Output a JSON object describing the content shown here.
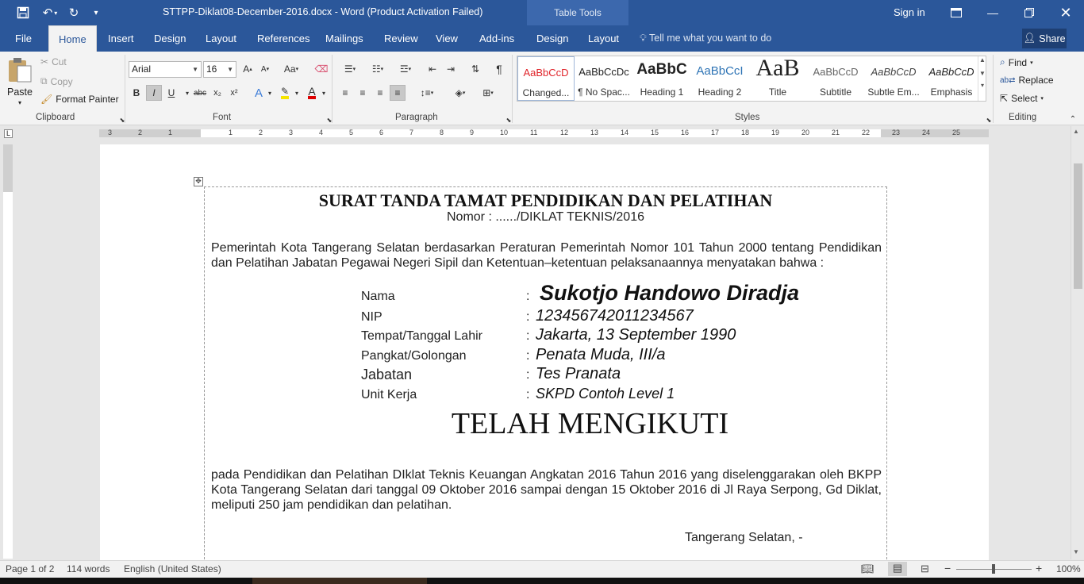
{
  "titlebar": {
    "doc_title": "STTPP-Diklat08-December-2016.docx  -  Word (Product Activation Failed)",
    "table_tools": "Table Tools",
    "sign_in": "Sign in",
    "share": "Share"
  },
  "tabs": [
    "File",
    "Home",
    "Insert",
    "Design",
    "Layout",
    "References",
    "Mailings",
    "Review",
    "View",
    "Add-ins",
    "Design",
    "Layout"
  ],
  "tell_me": "Tell me what you want to do",
  "clipboard": {
    "paste": "Paste",
    "cut": "Cut",
    "copy": "Copy",
    "format_painter": "Format Painter",
    "label": "Clipboard"
  },
  "font": {
    "name": "Arial",
    "size": "16",
    "label": "Font",
    "bold": "B",
    "italic": "I",
    "underline": "U",
    "strike": "abc",
    "sub": "x₂",
    "sup": "x²",
    "case": "Aa"
  },
  "paragraph": {
    "label": "Paragraph"
  },
  "styles": {
    "label": "Styles",
    "items": [
      {
        "preview": "AaBbCcD",
        "name": "Changed...",
        "color": "#e0242a"
      },
      {
        "preview": "AaBbCcDc",
        "name": "¶ No Spac...",
        "color": "#111111"
      },
      {
        "preview": "AaBbC",
        "name": "Heading 1",
        "color": "#111111"
      },
      {
        "preview": "AaBbCcI",
        "name": "Heading 2",
        "color": "#2e74b5"
      },
      {
        "preview": "AaB",
        "name": "Title",
        "color": "#111111"
      },
      {
        "preview": "AaBbCcD",
        "name": "Subtitle",
        "color": "#666666"
      },
      {
        "preview": "AaBbCcD",
        "name": "Subtle Em...",
        "color": "#444444"
      },
      {
        "preview": "AaBbCcD",
        "name": "Emphasis",
        "color": "#222222"
      }
    ]
  },
  "editing": {
    "find": "Find",
    "replace": "Replace",
    "select": "Select",
    "label": "Editing"
  },
  "ruler_marks": [
    "3",
    "2",
    "1",
    "1",
    "2",
    "3",
    "4",
    "5",
    "6",
    "7",
    "8",
    "9",
    "10",
    "11",
    "12",
    "13",
    "14",
    "15",
    "16",
    "17",
    "18",
    "19",
    "20",
    "21",
    "22",
    "23",
    "24",
    "25"
  ],
  "document": {
    "title": "SURAT TANDA TAMAT PENDIDIKAN DAN PELATIHAN",
    "nomor": "Nomor : ....../DIKLAT TEKNIS/2016",
    "intro": "Pemerintah Kota Tangerang Selatan berdasarkan Peraturan Pemerintah Nomor 101 Tahun 2000 tentang Pendidikan dan Pelatihan Jabatan Pegawai Negeri Sipil dan Ketentuan–ketentuan pelaksanaannya menyatakan bahwa :",
    "fields": [
      {
        "label": "Nama",
        "colon": ":",
        "value": "Sukotjo Handowo Diradja"
      },
      {
        "label": "NIP",
        "colon": ":",
        "value": "123456742011234567"
      },
      {
        "label": "Tempat/Tanggal Lahir",
        "colon": ":",
        "value": "Jakarta, 13 September 1990"
      },
      {
        "label": "Pangkat/Golongan",
        "colon": ":",
        "value": "Penata Muda, III/a"
      },
      {
        "label": "Jabatan",
        "colon": ":",
        "value": "Tes Pranata"
      },
      {
        "label": "Unit Kerja",
        "colon": ":",
        "value": "SKPD Contoh Level 1"
      }
    ],
    "heading2": "TELAH MENGIKUTI",
    "body": "pada Pendidikan dan Pelatihan DIklat Teknis Keuangan Angkatan 2016 Tahun 2016 yang diselenggarakan oleh BKPP Kota Tangerang Selatan dari tanggal 09 Oktober 2016 sampai dengan 15 Oktober 2016 di Jl Raya Serpong, Gd Diklat, meliputi 250 jam pendidikan dan pelatihan.",
    "place": "Tangerang Selatan, -"
  },
  "status": {
    "page": "Page 1 of 2",
    "words": "114 words",
    "language": "English (United States)",
    "zoom": "100%"
  }
}
